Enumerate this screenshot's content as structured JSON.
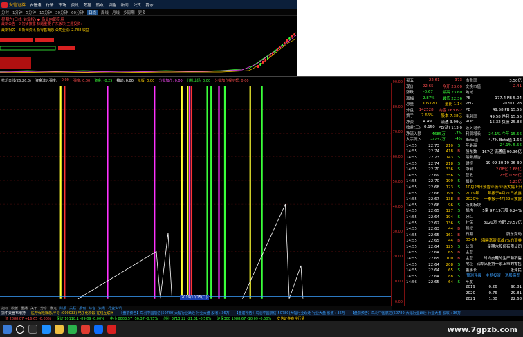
{
  "menubar": {
    "brand": "安信证券",
    "items": [
      "安信通",
      "行情",
      "市场",
      "资讯",
      "数据",
      "热点",
      "功能",
      "新闻",
      "公式",
      "提示"
    ]
  },
  "toolbar": {
    "periods": [
      "分时",
      "1分钟",
      "5分钟",
      "15分钟",
      "30分钟",
      "60分钟",
      "日线",
      "周线",
      "月线",
      "多周期",
      "更多"
    ],
    "active_period": "日线"
  },
  "stock_title": "星期六(日线 前复权)  ◆ 鸟鼠内部专用",
  "info_lines": [
    {
      "text": "最新公告  :  2   初步披露   标题重要  广东板块        主题投资:",
      "color": "#ff4040"
    },
    {
      "text": "最新相关  :  3   新闻资讯    新零售概念              公司业绩: 2.788       收益",
      "color": "#ffd000"
    }
  ],
  "indicator": {
    "title": "抗乐日线(26,26,3)",
    "items": [
      {
        "text": "资金流入强度:",
        "color": "#ffffff"
      },
      {
        "text": "0.00",
        "color": "#ff4d4d"
      },
      {
        "text": "强度: 0.00",
        "color": "#ff4d4d"
      },
      {
        "text": "资金: -0.25",
        "color": "#3aff3a"
      },
      {
        "text": "推动: 0.00",
        "color": "#ffffff"
      },
      {
        "text": "抢板: 0.00",
        "color": "#ffd000"
      },
      {
        "text": "分批加仓: 0.00",
        "color": "#ff4dff"
      },
      {
        "text": "分批出场: 0.00",
        "color": "#3aff3a"
      },
      {
        "text": "分批加仓提示帮: 0.00",
        "color": "#ff4d4d"
      },
      {
        "text": "分批加仓提示帮: 0.00",
        "color": "#ffd000"
      }
    ]
  },
  "scale_labels": [
    "90.00",
    "80.00",
    "70.00",
    "60.00",
    "50.00",
    "40.00",
    "30.00",
    "20.00",
    "10.00",
    "0.00"
  ],
  "quote": {
    "top_rows": [
      {
        "label": "买五",
        "value": "22.61",
        "extra": "373",
        "color": "#ff4d4d"
      },
      {
        "label": "现价",
        "value": "22.65",
        "extra": "今开 23.00",
        "color": "#ff4d4d"
      },
      {
        "label": "涨跌",
        "value": "-0.67",
        "extra": "最高 23.60",
        "color": "#3aff3a"
      },
      {
        "label": "涨幅",
        "value": "-2.87%",
        "extra": "最低 22.36",
        "color": "#3aff3a"
      },
      {
        "label": "总量",
        "value": "305720",
        "extra": "量比 1.14",
        "color": "#ffd000"
      },
      {
        "label": "外盘",
        "value": "142528",
        "extra": "内盘 163192",
        "color": "#ff4d4d"
      },
      {
        "label": "换手",
        "value": "7.66%",
        "extra": "股本 7.38亿",
        "color": "#ffd000"
      },
      {
        "label": "净资",
        "value": "4.49",
        "extra": "流通 3.99亿",
        "color": "#ffffff"
      },
      {
        "label": "收益(三)",
        "value": "0.150",
        "extra": "PE(动) 113.0",
        "color": "#ffffff"
      },
      {
        "label": "净流入额",
        "value": "-4685万",
        "extra": "-7%",
        "color": "#3aff3a"
      },
      {
        "label": "大宗流入",
        "value": "-2732万",
        "extra": "-4%",
        "color": "#3aff3a"
      }
    ],
    "trades": [
      [
        "14:55",
        "22.73",
        "210",
        "S"
      ],
      [
        "14:55",
        "22.74",
        "418",
        "B"
      ],
      [
        "14:55",
        "22.73",
        "143",
        "S"
      ],
      [
        "14:55",
        "22.74",
        "218",
        "S"
      ],
      [
        "14:55",
        "22.70",
        "336",
        "S"
      ],
      [
        "14:55",
        "22.69",
        "356",
        "S"
      ],
      [
        "14:55",
        "22.70",
        "199",
        "S"
      ],
      [
        "14:55",
        "22.68",
        "123",
        "S"
      ],
      [
        "14:55",
        "22.66",
        "199",
        "S"
      ],
      [
        "14:55",
        "22.67",
        "138",
        "B"
      ],
      [
        "14:55",
        "22.66",
        "96",
        "S"
      ],
      [
        "14:55",
        "22.65",
        "127",
        "S"
      ],
      [
        "14:55",
        "22.64",
        "194",
        "S"
      ],
      [
        "14:55",
        "22.62",
        "136",
        "S"
      ],
      [
        "14:55",
        "22.63",
        "44",
        "B"
      ],
      [
        "14:55",
        "22.65",
        "161",
        "B"
      ],
      [
        "14:55",
        "22.65",
        "44",
        "B"
      ],
      [
        "14:55",
        "22.64",
        "125",
        "S"
      ],
      [
        "14:55",
        "22.64",
        "65",
        "B"
      ],
      [
        "14:55",
        "22.65",
        "100",
        "B"
      ],
      [
        "14:55",
        "22.64",
        "208",
        "S"
      ],
      [
        "14:55",
        "22.64",
        "65",
        "S"
      ],
      [
        "14:55",
        "22.64",
        "88",
        "S"
      ],
      [
        "14:56",
        "22.65",
        "64",
        "S"
      ],
      [
        "14:56",
        "22.64",
        "32",
        "S"
      ],
      [
        "14:56",
        "22.65",
        "1428",
        "B"
      ]
    ]
  },
  "f10": {
    "rows": [
      {
        "l": "市盈率",
        "r": "3.50亿",
        "lc": "#ddd",
        "rc": "#fff"
      },
      {
        "l": "交换市值",
        "r": "2.41",
        "lc": "#ddd",
        "rc": "#ff4d4d"
      },
      {
        "l": "地域",
        "r": "",
        "lc": "#ddd",
        "rc": "#ddd"
      },
      {
        "l": "PE",
        "r": "177.4 PB 5.04",
        "lc": "#ddd",
        "rc": "#fff"
      },
      {
        "l": "PEG",
        "r": "2020.0 PB",
        "lc": "#ddd",
        "rc": "#fff"
      },
      {
        "l": "PE",
        "r": "49.58 PB 15.55",
        "lc": "#ddd",
        "rc": "#fff"
      },
      {
        "l": "毛利率",
        "r": "49.58 净利 15.55",
        "lc": "#ddd",
        "rc": "#fff"
      },
      {
        "l": "ROE",
        "r": "15.32 负债 25.88",
        "lc": "#ddd",
        "rc": "#fff"
      },
      {
        "l": "收入增长",
        "r": "",
        "lc": "#ddd",
        "rc": "#ddd"
      },
      {
        "l": "利润增长",
        "r": "-24.1% 今年 15.56",
        "lc": "#ddd",
        "rc": "#3aff3a"
      },
      {
        "l": "Beta值",
        "r": "4.7% Beta值 1.66",
        "lc": "#ddd",
        "rc": "#fff"
      },
      {
        "l": "年最高",
        "r": "-24.1% 5.56",
        "lc": "#ddd",
        "rc": "#3aff3a"
      },
      {
        "l": "股东数",
        "r": "167亿 流通值 90.36亿",
        "lc": "#ddd",
        "rc": "#fff"
      },
      {
        "l": "最新报告",
        "r": "",
        "lc": "#ddd",
        "rc": "#ddd"
      },
      {
        "l": "财报",
        "r": "19-09-30  19-06-30",
        "lc": "#ddd",
        "rc": "#fff"
      },
      {
        "l": "净利",
        "r": "2.08亿  1.68亿",
        "lc": "#ddd",
        "rc": "#ff4d4d"
      },
      {
        "l": "营收",
        "r": "1.23亿  0.58亿",
        "lc": "#ddd",
        "rc": "#ff4d4d"
      },
      {
        "l": "扣非",
        "r": "1.23亿",
        "lc": "#ddd",
        "rc": "#ff4d4d"
      },
      {
        "l": "10月28日",
        "r": "预告业绩:业绩大幅上升",
        "lc": "#ffd000",
        "rc": "#ffd000"
      },
      {
        "l": "2019年",
        "r": "年报于4月21日披露",
        "lc": "#ffd000",
        "rc": "#ffd000"
      },
      {
        "l": "2020年",
        "r": "一季报于4月29日披露",
        "lc": "#ffd000",
        "rc": "#ffd000"
      },
      {
        "l": "所属板块",
        "r": "",
        "lc": "#ddd",
        "rc": "#ddd"
      },
      {
        "l": "机构",
        "r": "5家  97.19万股 0.24%",
        "lc": "#ddd",
        "rc": "#fff"
      },
      {
        "l": "分红",
        "r": "",
        "lc": "#ddd",
        "rc": "#ddd"
      },
      {
        "l": "社保",
        "r": "8020万 分配 29.57亿",
        "lc": "#ddd",
        "rc": "#fff"
      },
      {
        "l": "股权",
        "r": "",
        "lc": "#ddd",
        "rc": "#ddd"
      },
      {
        "l": "日期",
        "r": "股东变动",
        "lc": "#ddd",
        "rc": "#ddd"
      },
      {
        "l": "03-24",
        "r": "海曦富资增减7%的证券",
        "lc": "#ffd000",
        "rc": "#ffd000"
      },
      {
        "l": "公司",
        "r": "星期六股份有限公司",
        "lc": "#ddd",
        "rc": "#fff"
      },
      {
        "l": "主营",
        "r": "",
        "lc": "#ddd",
        "rc": "#ddd"
      },
      {
        "l": "主营",
        "r": "时尚皮鞋的生产和销售",
        "lc": "#ddd",
        "rc": "#fff"
      },
      {
        "l": "地址",
        "r": "深圳A股第一家上市的零售",
        "lc": "#ddd",
        "rc": "#fff"
      },
      {
        "l": "董事长",
        "r": "张泽民",
        "lc": "#ddd",
        "rc": "#fff"
      }
    ],
    "tabs": [
      "预测评级",
      "主题投资",
      "选股高图"
    ],
    "forecast": [
      {
        "y": "年度",
        "a": "",
        "b": ""
      },
      {
        "y": "2019",
        "a": "0.26",
        "b": "90.81"
      },
      {
        "y": "2020",
        "a": "0.76",
        "b": "29.81"
      },
      {
        "y": "2021",
        "a": "1.00",
        "b": "22.68"
      }
    ]
  },
  "bottom_tabs": [
    "指标",
    "模板",
    "重播",
    "关于",
    "分享",
    "删定"
  ],
  "bottom_tabs2": [
    "财报",
    "关联",
    "报刊",
    "综合",
    "资讯",
    "行业资讯"
  ],
  "date_tag": "2019/10/15(二)",
  "news_items": [
    {
      "text": "振中天宣布增持",
      "color": "#fff"
    },
    {
      "text": "医疗保险概念,半导 (000033) 电子化阶段 在线互联网",
      "color": "#ffd000"
    },
    {
      "text": "【盘前预告】鸟羽中国航信(50780)大幅行业跃迁 行业大盘 股收 : 36万",
      "color": "#3aa0ff"
    },
    {
      "text": "【盘前预告】鸟羽中国航信(50780)大幅行业跃迁 行业大盘 股收 : 36万",
      "color": "#3aa0ff"
    },
    {
      "text": "【盘前预告】鸟羽中国航信(50780)大幅行业跃迁 行业大盘 股收 : 36万",
      "color": "#3aa0ff"
    }
  ],
  "index_items": [
    {
      "text": "上证 2888.07 +16.65 -0.60%",
      "color": "#ff4d4d"
    },
    {
      "text": "深证 10118.1 -89.09 -0.00%",
      "color": "#3aff3a"
    },
    {
      "text": "中小 8003.57 -50.37 -0.75%",
      "color": "#3aff3a"
    },
    {
      "text": "创业 3713.22 -21.31 -0.56%",
      "color": "#3aff3a"
    },
    {
      "text": "沪深300 1988.67 -10.09 -0.50%",
      "color": "#3aff3a"
    },
    {
      "text": "安信证券鹿伴行情",
      "color": "#ffd000"
    }
  ],
  "watermark": "www.7gpzb.com",
  "chart_data": {
    "type": "line",
    "ylim": [
      0,
      90
    ],
    "bars": [
      {
        "x": 0.155,
        "color": "#ffff33",
        "h": 90
      },
      {
        "x": 0.165,
        "color": "#ff3333",
        "h": 90
      },
      {
        "x": 0.275,
        "color": "#ff33ff",
        "h": 90
      },
      {
        "x": 0.395,
        "color": "#ff33ff",
        "h": 90
      },
      {
        "x": 0.465,
        "color": "#ffff33",
        "h": 90
      },
      {
        "x": 0.48,
        "color": "#ffff33",
        "h": 90
      },
      {
        "x": 0.485,
        "color": "#ff33ff",
        "h": 90
      },
      {
        "x": 0.49,
        "color": "#ff3333",
        "h": 90
      },
      {
        "x": 0.53,
        "color": "#3aff3a",
        "h": 90
      },
      {
        "x": 0.54,
        "color": "#3aff3a",
        "h": 90
      },
      {
        "x": 0.56,
        "color": "#ff33ff",
        "h": 90
      },
      {
        "x": 0.575,
        "color": "#3aff3a",
        "h": 90
      },
      {
        "x": 0.64,
        "color": "#ffff33",
        "h": 90
      },
      {
        "x": 0.67,
        "color": "#3aff3a",
        "h": 90
      }
    ],
    "lines": [
      {
        "color": "#ffffff",
        "points": [
          [
            0.2,
            0
          ],
          [
            0.4,
            20
          ],
          [
            0.41,
            0
          ],
          [
            0.43,
            28
          ],
          [
            0.44,
            0
          ]
        ]
      },
      {
        "color": "#ffffff",
        "points": [
          [
            0.62,
            0
          ],
          [
            0.73,
            40
          ],
          [
            0.74,
            0
          ]
        ]
      },
      {
        "color": "#ffffff",
        "points": [
          [
            0.74,
            0
          ],
          [
            0.77,
            14
          ],
          [
            0.775,
            0
          ]
        ]
      },
      {
        "color": "#3aa0ff",
        "points": [
          [
            0,
            1
          ],
          [
            1,
            1
          ]
        ]
      }
    ],
    "mini_candles_note": ""
  }
}
